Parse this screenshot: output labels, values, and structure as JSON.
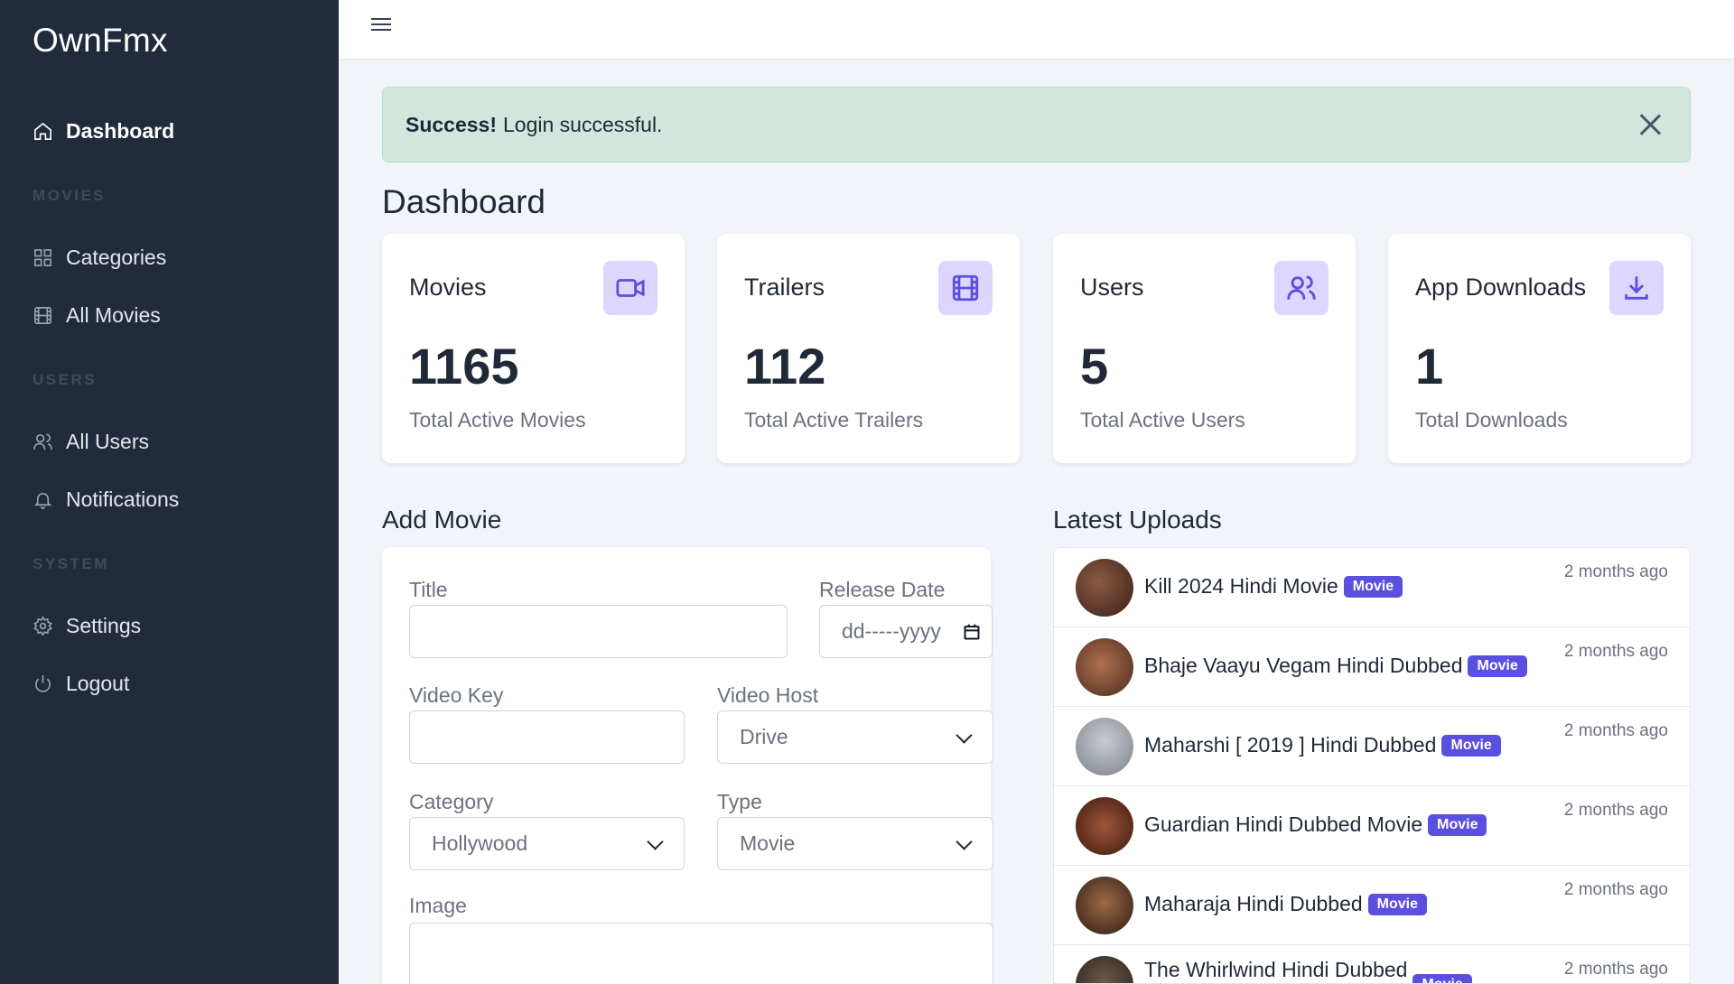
{
  "brand": "OwnFmx",
  "sidebar": {
    "dashboard": "Dashboard",
    "section_movies": "MOVIES",
    "categories": "Categories",
    "all_movies": "All Movies",
    "section_users": "USERS",
    "all_users": "All Users",
    "notifications": "Notifications",
    "section_system": "SYSTEM",
    "settings": "Settings",
    "logout": "Logout"
  },
  "alert": {
    "strong": "Success!",
    "message": "Login successful."
  },
  "page_title": "Dashboard",
  "stats": [
    {
      "title": "Movies",
      "value": "1165",
      "sub": "Total Active Movies",
      "icon": "video-camera-icon"
    },
    {
      "title": "Trailers",
      "value": "112",
      "sub": "Total Active Trailers",
      "icon": "film-icon"
    },
    {
      "title": "Users",
      "value": "5",
      "sub": "Total Active Users",
      "icon": "users-icon"
    },
    {
      "title": "App Downloads",
      "value": "1",
      "sub": "Total Downloads",
      "icon": "download-icon"
    }
  ],
  "add_movie": {
    "heading": "Add Movie",
    "title_label": "Title",
    "title_value": "",
    "release_label": "Release Date",
    "release_placeholder": "dd-----yyyy",
    "video_key_label": "Video Key",
    "video_key_value": "",
    "video_host_label": "Video Host",
    "video_host_value": "Drive",
    "category_label": "Category",
    "category_value": "Hollywood",
    "type_label": "Type",
    "type_value": "Movie",
    "image_label": "Image"
  },
  "latest": {
    "heading": "Latest Uploads",
    "items": [
      {
        "title": "Kill 2024 Hindi Movie",
        "badge": "Movie",
        "time": "2 months ago"
      },
      {
        "title": "Bhaje Vaayu Vegam Hindi Dubbed",
        "badge": "Movie",
        "time": "2 months ago"
      },
      {
        "title": "Maharshi [ 2019 ] Hindi Dubbed",
        "badge": "Movie",
        "time": "2 months ago"
      },
      {
        "title": "Guardian Hindi Dubbed Movie",
        "badge": "Movie",
        "time": "2 months ago"
      },
      {
        "title": "Maharaja Hindi Dubbed",
        "badge": "Movie",
        "time": "2 months ago"
      },
      {
        "title": "The Whirlwind Hindi Dubbed",
        "badge": "Movie",
        "time": "2 months ago"
      }
    ]
  },
  "colors": {
    "sidebar_bg": "#222b3c",
    "accent": "#5b4fe0",
    "accent_soft": "#ddd6fe",
    "alert_bg": "#d1e7dd"
  }
}
